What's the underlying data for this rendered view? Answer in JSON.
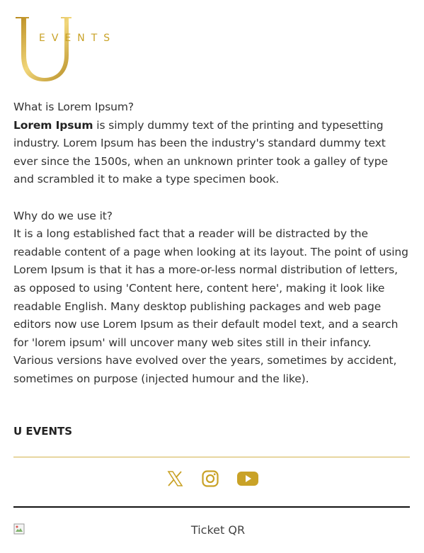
{
  "brand": {
    "logo_text": "EVENTS",
    "logo_letter": "U",
    "accent_color": "#c9a227"
  },
  "content": {
    "heading1": "What is Lorem Ipsum?",
    "bold_lead": "Lorem Ipsum",
    "para1": " is simply dummy text of the printing and typesetting industry. Lorem Ipsum has been the industry's standard dummy text ever since the 1500s, when an unknown printer took a galley of type and scrambled it to make a type specimen book.",
    "heading2": "Why do we use it?",
    "para2": "It is a long established fact that a reader will be distracted by the readable content of a page when looking at its layout. The point of using Lorem Ipsum is that it has a more-or-less normal distribution of letters, as opposed to using 'Content here, content here', making it look like readable English. Many desktop publishing packages and web page editors now use Lorem Ipsum as their default model text, and a search for 'lorem ipsum' will uncover many web sites still in their infancy. Various versions have evolved over the years, sometimes by accident, sometimes on purpose (injected humour and the like)."
  },
  "footer": {
    "title": "U EVENTS",
    "social": [
      "x-icon",
      "instagram-icon",
      "youtube-icon"
    ]
  },
  "ticket": {
    "qr_alt": "Ticket QR"
  }
}
